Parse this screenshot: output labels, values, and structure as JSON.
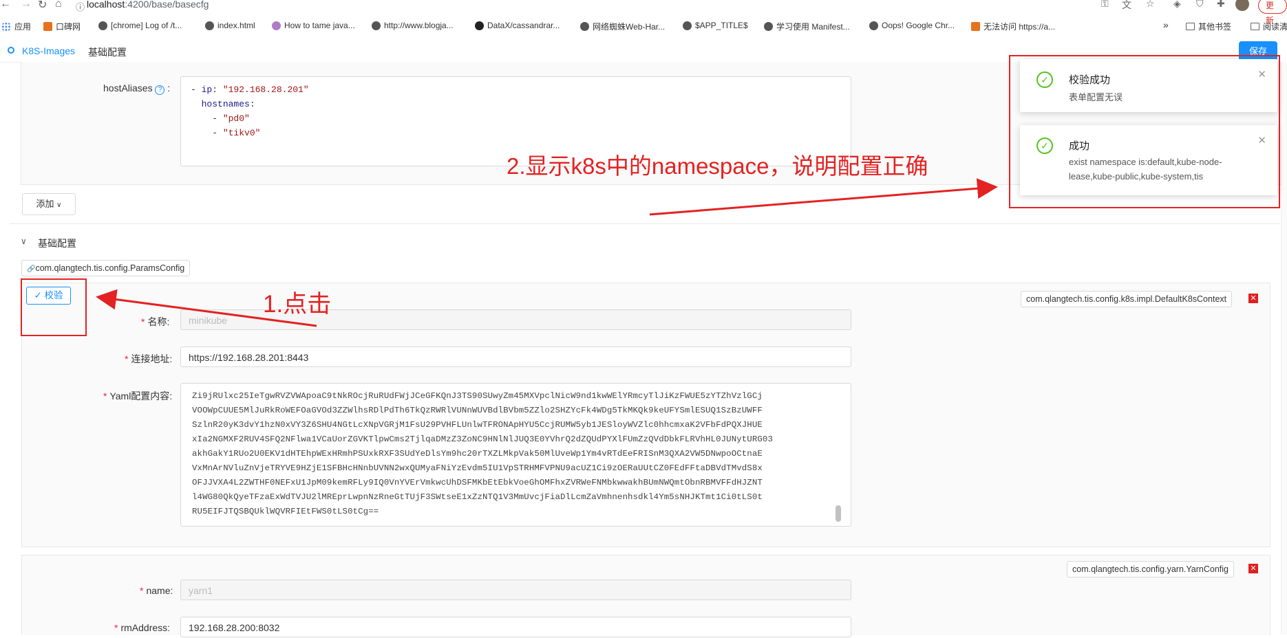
{
  "browser": {
    "address": {
      "host": "localhost",
      "path": ":4200/base/basecfg"
    },
    "update_button": "更新",
    "bookmarks": [
      {
        "label": "应用",
        "icon": "apps-grid-icon"
      },
      {
        "label": "口碑网",
        "icon": "koubei-icon"
      },
      {
        "label": "[chrome] Log of /t...",
        "icon": "globe-icon"
      },
      {
        "label": "index.html",
        "icon": "globe-icon"
      },
      {
        "label": "How to tame java...",
        "icon": "globe-icon"
      },
      {
        "label": "http://www.blogja...",
        "icon": "globe-icon"
      },
      {
        "label": "DataX/cassandrar...",
        "icon": "github-icon"
      },
      {
        "label": "网络蜘蛛Web-Har...",
        "icon": "globe-icon"
      },
      {
        "label": "$APP_TITLE$",
        "icon": "globe-icon"
      },
      {
        "label": "学习使用 Manifest...",
        "icon": "globe-icon"
      },
      {
        "label": "Oops! Google Chr...",
        "icon": "globe-icon"
      },
      {
        "label": "无法访问 https://a...",
        "icon": "error-icon"
      },
      {
        "label": "»",
        "icon": ""
      },
      {
        "label": "其他书签",
        "icon": "folder-icon"
      },
      {
        "label": "阅读清",
        "icon": "reading-list-icon"
      }
    ]
  },
  "header": {
    "crumb_project": "K8S-Images",
    "crumb_page": "基础配置",
    "save_label": "保存"
  },
  "host_aliases": {
    "label": "hostAliases",
    "yaml": [
      {
        "indent": "",
        "dash": "- ",
        "key": "ip",
        "value": "\"192.168.28.201\""
      },
      {
        "indent": "  ",
        "dash": "",
        "key": "hostnames",
        "value": ""
      },
      {
        "indent": "    ",
        "dash": "- ",
        "key": "",
        "value": "\"pd0\""
      },
      {
        "indent": "    ",
        "dash": "- ",
        "key": "",
        "value": "\"tikv0\""
      }
    ]
  },
  "add_button": "添加",
  "section": {
    "title": "基础配置",
    "plugin_tag": "com.qlangtech.tis.config.ParamsConfig",
    "verify_button": "校验"
  },
  "k8s_form": {
    "class_tag": "com.qlangtech.tis.config.k8s.impl.DefaultK8sContext",
    "name_label": "名称",
    "name_value": "minikube",
    "url_label": "连接地址",
    "url_value": "https://192.168.28.201:8443",
    "yaml_label": "Yaml配置内容",
    "yaml_lines": [
      "Zi9jRUlxc25IeTgwRVZVWApoaC9tNkROcjRuRUdFWjJCeGFKQnJ3TS90SUwyZm45MXVpclNicW9nd1kwWElYRmcyTlJiKzFWUE5zYTZhVzlGCj",
      "VOOWpCUUE5MlJuRkRoWEFOaGVOd3ZZWlhsRDlPdTh6TkQzRWRlVUNnWUVBdlBVbm5ZZlo2SHZYcFk4WDg5TkMKQk9keUFYSmlESUQ1SzBzUWFF",
      "SzlnR20yK3dvY1hzN0xVY3Z6SHU4NGtLcXNpVGRjM1FsU29PVHFLUnlwTFRONApHYU5CcjRUMW5yb1JESloyWVZlc0hhcmxaK2VFbFdPQXJHUE",
      "xIa2NGMXF2RUV4SFQ2NFlwa1VCaUorZGVKTlpwCms2TjlqaDMzZ3ZoNC9HNlNlJUQ3E0YVhrQ2dZQUdPYXlFUmZzQVdDbkFLRVhHL0JUNytURG03",
      "akhGakY1RUo2U0EKV1dHTEhpWExHRmhPSUxkRXF3SUdYeDlsYm9hc20rTXZLMkpVak50MlUveWp1Ym4vRTdEeFRISnM3QXA2VW5DNwpoOCtnaE",
      "VxMnArNVluZnVjeTRYVE9HZjE1SFBHcHNnbUVNN2wxQUMyaFNiYzEvdm5IU1VpSTRHMFVPNU9acUZ1Ci9zOERaUUtCZ0FEdFFtaDBVdTMvdS8x",
      "OFJJVXA4L2ZWTHF0NEFxU1JpM09kemRFLy9IQ0VnYVErVmkwcUhDSFMKbEtEbkVoeGhOMFhxZVRWeFNMbkwwakhBUmNWQmtObnRBMVFFdHJZNT",
      "l4WG80QkQyeTFzaExWdTVJU2lMREprLwpnNzRneGtTUjF3SWtseE1xZzNTQ1V3MmUvcjFiaDlLcmZaVmhnenhsdkl4Ym5sNHJKTmt1Ci0tLS0t",
      "RU5EIFJTQSBQUklWQVRFIEtFWS0tLS0tCg=="
    ]
  },
  "yarn_form": {
    "class_tag": "com.qlangtech.tis.config.yarn.YarnConfig",
    "name_label": "name",
    "name_value": "yarn1",
    "rm_label": "rmAddress",
    "rm_value": "192.168.28.200:8032"
  },
  "notifications": [
    {
      "title": "校验成功",
      "body": "表单配置无误"
    },
    {
      "title": "成功",
      "body_line1": "exist namespace is:default,kube-node-",
      "body_line2": "lease,kube-public,kube-system,tis"
    }
  ],
  "annotations": {
    "step1": "1.点击",
    "step2": "2.显示k8s中的namespace，说明配置正确"
  },
  "colors": {
    "accent": "#1890ff",
    "annotation": "#e32222",
    "success": "#52c41a"
  }
}
